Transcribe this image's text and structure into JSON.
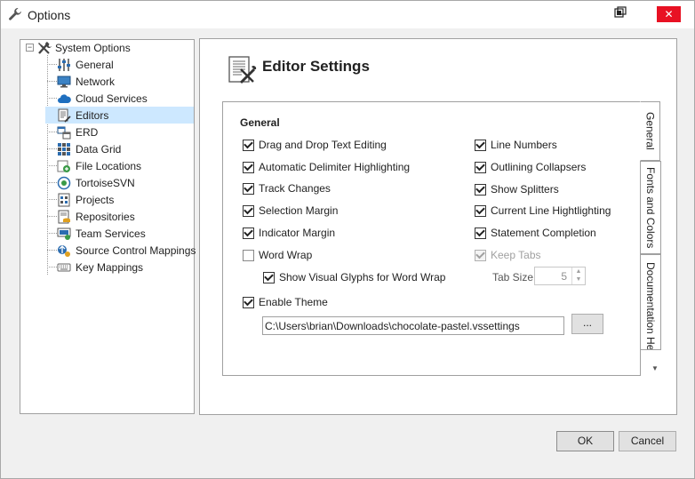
{
  "window": {
    "title": "Options",
    "close_glyph": "✕"
  },
  "tree": {
    "root_label": "System Options",
    "expander": "−",
    "items": [
      {
        "label": "General",
        "icon": "sliders-icon"
      },
      {
        "label": "Network",
        "icon": "monitor-icon"
      },
      {
        "label": "Cloud Services",
        "icon": "cloud-icon"
      },
      {
        "label": "Editors",
        "icon": "editor-icon",
        "selected": true
      },
      {
        "label": "ERD",
        "icon": "erd-icon"
      },
      {
        "label": "Data Grid",
        "icon": "grid-icon"
      },
      {
        "label": "File Locations",
        "icon": "folder-icon"
      },
      {
        "label": "TortoiseSVN",
        "icon": "tortoise-icon"
      },
      {
        "label": "Projects",
        "icon": "projects-icon"
      },
      {
        "label": "Repositories",
        "icon": "repository-icon"
      },
      {
        "label": "Team Services",
        "icon": "team-icon"
      },
      {
        "label": "Source Control Mappings",
        "icon": "source-control-icon"
      },
      {
        "label": "Key Mappings",
        "icon": "keyboard-icon"
      }
    ]
  },
  "content": {
    "title": "Editor Settings"
  },
  "tabs": [
    {
      "label": "General",
      "active": true
    },
    {
      "label": "Fonts and Colors",
      "active": false
    },
    {
      "label": "Documentation Hea",
      "active": false
    }
  ],
  "general": {
    "group_title": "General",
    "left_options": [
      {
        "label": "Drag and Drop Text Editing",
        "checked": true
      },
      {
        "label": "Automatic Delimiter Highlighting",
        "checked": true
      },
      {
        "label": "Track Changes",
        "checked": true
      },
      {
        "label": "Selection Margin",
        "checked": true
      },
      {
        "label": "Indicator Margin",
        "checked": true
      },
      {
        "label": "Word Wrap",
        "checked": false
      }
    ],
    "right_options": [
      {
        "label": "Line Numbers",
        "checked": true
      },
      {
        "label": "Outlining Collapsers",
        "checked": true
      },
      {
        "label": "Show Splitters",
        "checked": true
      },
      {
        "label": "Current Line Hightlighting",
        "checked": true
      },
      {
        "label": "Statement Completion",
        "checked": true
      },
      {
        "label": "Keep Tabs",
        "checked": true,
        "disabled": true
      }
    ],
    "show_glyphs": {
      "label": "Show Visual Glyphs for Word Wrap",
      "checked": true
    },
    "tab_size_label": "Tab Size:",
    "tab_size_value": "5",
    "enable_theme": {
      "label": "Enable Theme",
      "checked": true
    },
    "theme_path": "C:\\Users\\brian\\Downloads\\chocolate-pastel.vssettings",
    "browse_label": "..."
  },
  "buttons": {
    "ok": "OK",
    "cancel": "Cancel"
  },
  "colors": {
    "selection": "#cde8ff",
    "close": "#e81123"
  }
}
